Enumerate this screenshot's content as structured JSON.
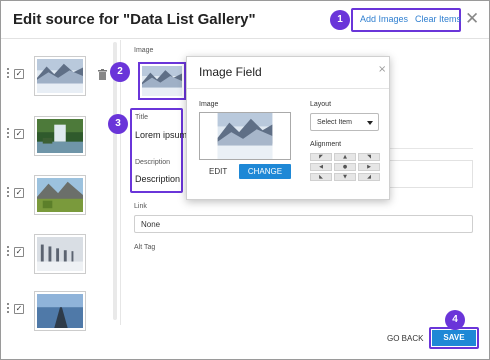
{
  "dialog": {
    "title": "Edit source for \"Data List Gallery\"",
    "close_symbol": "✕",
    "add_images_label": "Add Images",
    "clear_items_label": "Clear Items"
  },
  "badges": [
    "1",
    "2",
    "3",
    "4"
  ],
  "thumbnails": [
    {
      "icon": "mountain-lake-icon",
      "checked": "✓"
    },
    {
      "icon": "waterfall-icon",
      "checked": "✓"
    },
    {
      "icon": "mountain-meadow-icon",
      "checked": "✓"
    },
    {
      "icon": "winter-trees-icon",
      "checked": "✓"
    },
    {
      "icon": "pier-icon",
      "checked": "✓"
    }
  ],
  "form": {
    "image_label": "Image",
    "title_label": "Title",
    "title_value": "Lorem ipsum",
    "description_label": "Description",
    "description_value": "Description",
    "link_label": "Link",
    "link_value": "None",
    "alt_tag_label": "Alt Tag"
  },
  "image_field_modal": {
    "title": "Image Field",
    "close_symbol": "×",
    "image_label": "Image",
    "edit_label": "EDIT",
    "change_label": "CHANGE",
    "layout_label": "Layout",
    "layout_value": "Select Item",
    "alignment_label": "Alignment",
    "alignment_glyphs": [
      "◤",
      "▲",
      "◥",
      "◀",
      "●",
      "▶",
      "◣",
      "▼",
      "◢"
    ]
  },
  "footer": {
    "go_back_label": "GO BACK",
    "save_label": "SAVE"
  },
  "colors": {
    "accent_purple": "#6a35d9",
    "button_blue": "#1e88d6",
    "link_blue": "#2f7fd0"
  }
}
